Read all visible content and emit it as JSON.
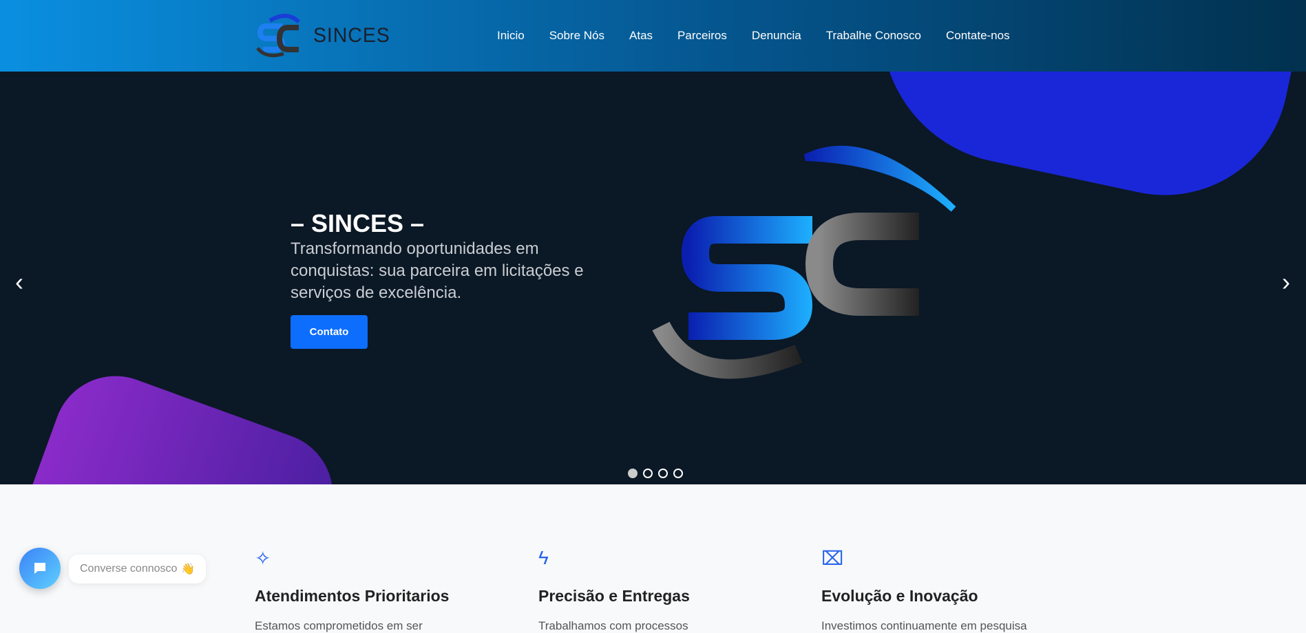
{
  "brand": {
    "name": "SINCES"
  },
  "nav": [
    "Inicio",
    "Sobre Nós",
    "Atas",
    "Parceiros",
    "Denuncia",
    "Trabalhe Conosco",
    "Contate-nos"
  ],
  "hero": {
    "title": "– SINCES –",
    "subtitle": "Transformando oportunidades em conquistas: sua parceira em licitações e serviços de excelência.",
    "button": "Contato",
    "slides": 4,
    "active_slide": 1
  },
  "features": [
    {
      "icon": "sparkles-icon",
      "title": "Atendimentos Prioritarios",
      "text": "Estamos comprometidos em ser"
    },
    {
      "icon": "lightning-icon",
      "title": "Precisão e Entregas",
      "text": "Trabalhamos com processos"
    },
    {
      "icon": "presentation-chart-icon",
      "title": "Evolução e Inovação",
      "text": "Investimos continuamente em pesquisa"
    }
  ],
  "chat": {
    "label": "Converse connosco",
    "emoji": "👋"
  },
  "colors": {
    "accent": "#0d6efd",
    "hero_bg": "#0b1825"
  }
}
